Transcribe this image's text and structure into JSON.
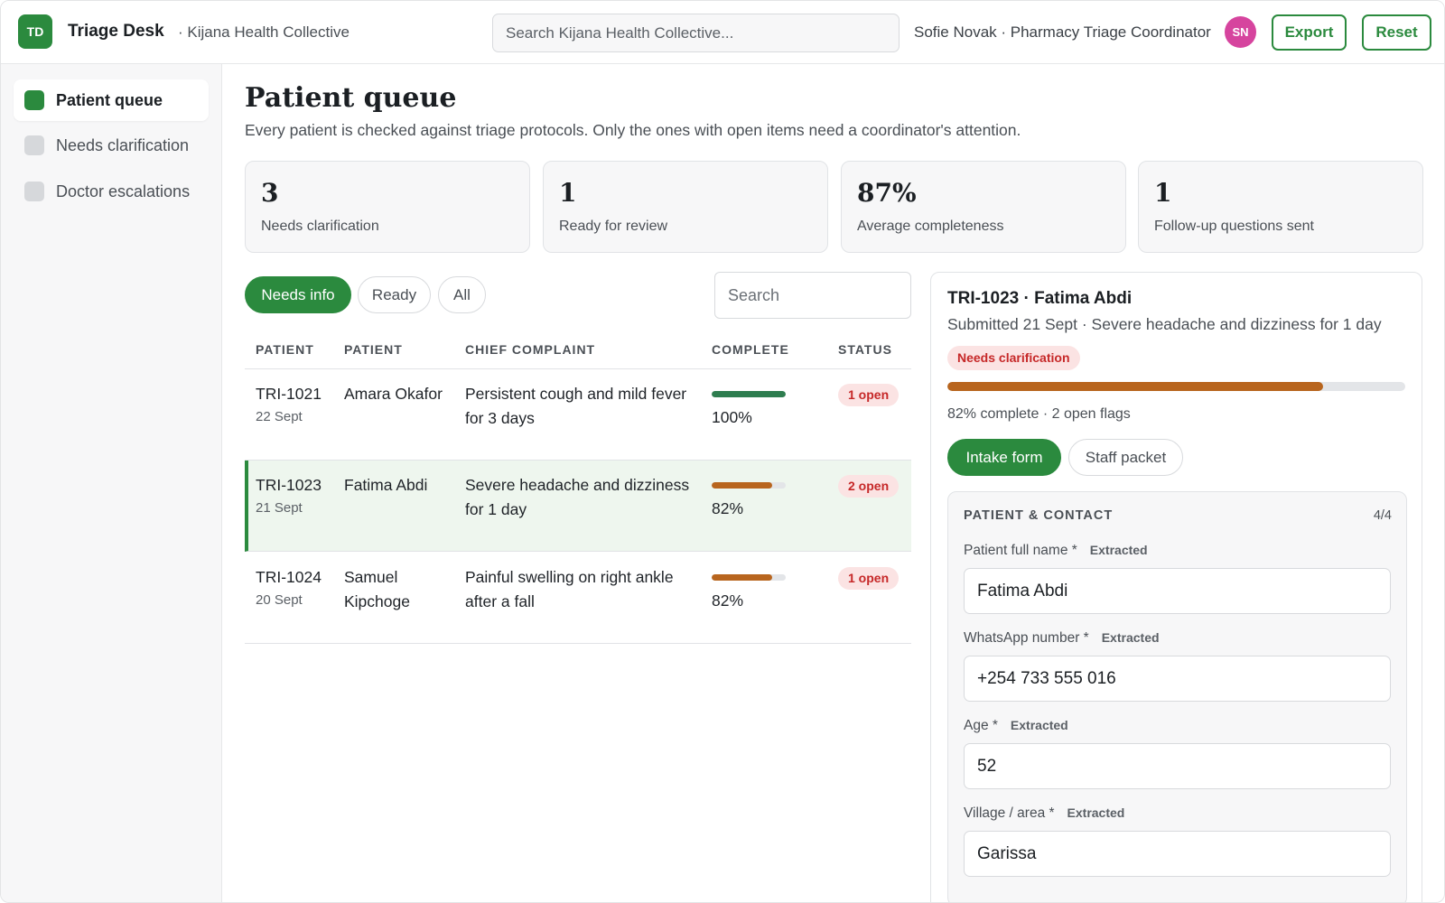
{
  "header": {
    "logo_initials": "TD",
    "app_title": "Triage Desk",
    "org_name": "· Kijana Health Collective",
    "search_placeholder": "Search Kijana Health Collective...",
    "user_label": "Sofie Novak · Pharmacy Triage Coordinator",
    "avatar_initials": "SN",
    "avatar_color": "#d6449e",
    "export_label": "Export",
    "reset_label": "Reset"
  },
  "sidebar": {
    "items": [
      {
        "label": "Patient queue",
        "active": true
      },
      {
        "label": "Needs clarification",
        "active": false
      },
      {
        "label": "Doctor escalations",
        "active": false
      }
    ]
  },
  "main": {
    "title": "Patient queue",
    "subtitle": "Every patient is checked against triage protocols. Only the ones with open items need a coordinator's attention.",
    "stats": [
      {
        "value": "3",
        "label": "Needs clarification"
      },
      {
        "value": "1",
        "label": "Ready for review"
      },
      {
        "value": "87%",
        "label": "Average completeness"
      },
      {
        "value": "1",
        "label": "Follow-up questions sent"
      }
    ],
    "filters": [
      {
        "label": "Needs info",
        "active": true
      },
      {
        "label": "Ready",
        "active": false
      },
      {
        "label": "All",
        "active": false
      }
    ],
    "table_search_placeholder": "Search",
    "columns": [
      "PATIENT",
      "PATIENT",
      "CHIEF COMPLAINT",
      "COMPLETE",
      "STATUS"
    ],
    "rows": [
      {
        "id": "TRI-1021",
        "date": "22 Sept",
        "name": "Amara Okafor",
        "complaint": "Persistent cough and mild fever for 3 days",
        "complete_label": "100%",
        "complete": 1.0,
        "bar_color": "#2e7d4f",
        "status": "1 open",
        "selected": false
      },
      {
        "id": "TRI-1023",
        "date": "21 Sept",
        "name": "Fatima Abdi",
        "complaint": "Severe headache and dizziness for 1 day",
        "complete_label": "82%",
        "complete": 0.82,
        "bar_color": "#b8651e",
        "status": "2 open",
        "selected": true
      },
      {
        "id": "TRI-1024",
        "date": "20 Sept",
        "name": "Samuel Kipchoge",
        "complaint": "Painful swelling on right ankle after a fall",
        "complete_label": "82%",
        "complete": 0.82,
        "bar_color": "#b8651e",
        "status": "1 open",
        "selected": false
      }
    ]
  },
  "detail": {
    "title": "TRI-1023 · Fatima Abdi",
    "subtitle": "Submitted 21 Sept · Severe headache and dizziness for 1 day",
    "badge": "Needs clarification",
    "progress": 0.82,
    "progress_color": "#b8651e",
    "progress_text": "82% complete · 2 open flags",
    "tabs": [
      {
        "label": "Intake form",
        "active": true
      },
      {
        "label": "Staff packet",
        "active": false
      }
    ],
    "section": {
      "title": "PATIENT & CONTACT",
      "count": "4/4",
      "fields": [
        {
          "label": "Patient full name *",
          "tag": "Extracted",
          "value": "Fatima Abdi"
        },
        {
          "label": "WhatsApp number *",
          "tag": "Extracted",
          "value": "+254 733 555 016"
        },
        {
          "label": "Age *",
          "tag": "Extracted",
          "value": "52"
        },
        {
          "label": "Village / area *",
          "tag": "Extracted",
          "value": "Garissa"
        }
      ]
    }
  },
  "colors": {
    "accent": "#2b8a3e",
    "danger_text": "#c62828",
    "danger_bg": "#fbe3e3"
  }
}
